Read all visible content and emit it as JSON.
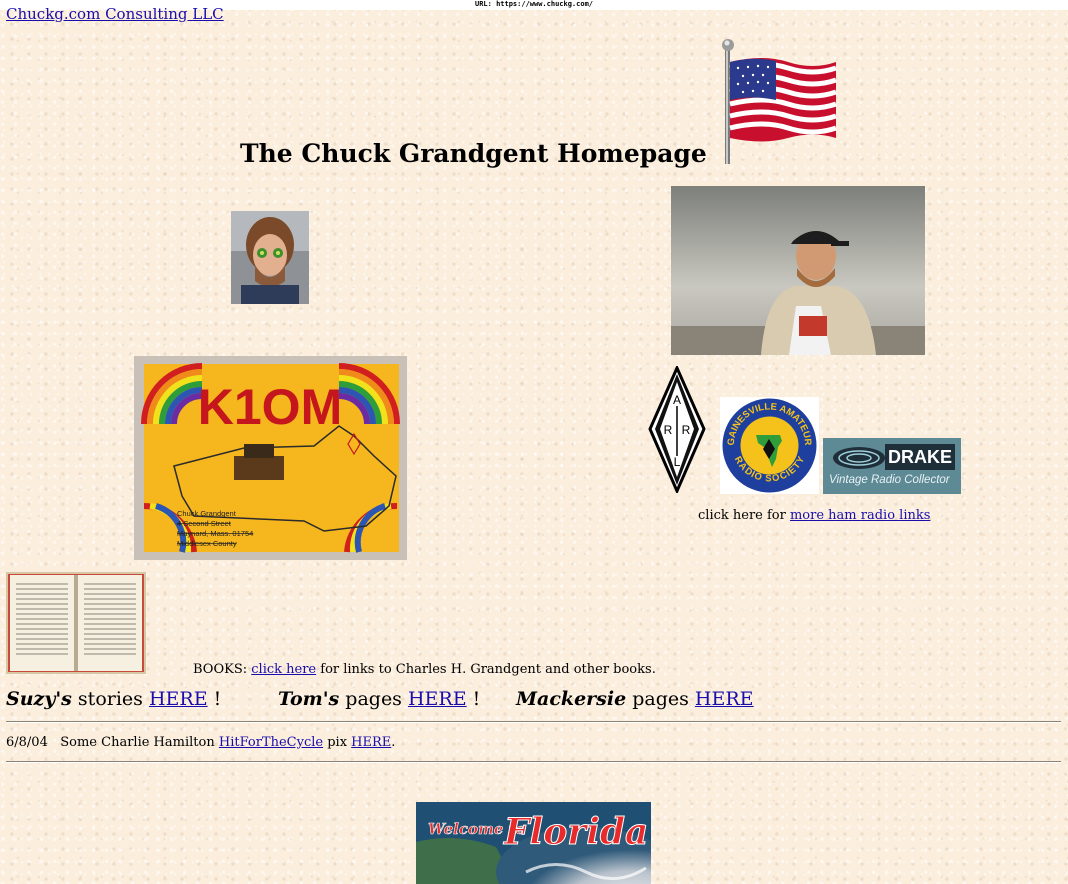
{
  "browser": {
    "url_label": "URL:",
    "url": "https://www.chuckg.com/"
  },
  "header": {
    "company_link": "Chuckg.com Consulting LLC",
    "title": "The Chuck Grandgent Homepage"
  },
  "qsl_card": {
    "callsign": "K1OM",
    "address_lines": [
      "Chuck Grandgent",
      "4 Second Street",
      "Maynard, Mass. 01754",
      "Middlesex County"
    ]
  },
  "ham": {
    "arrl_letters": [
      "A",
      "R",
      "R",
      "L"
    ],
    "gars_lines": [
      "GAINESVILLE AMATEUR",
      "RADIO SOCIETY"
    ],
    "drake_brand": "DRAKE",
    "drake_tagline": "Vintage Radio Collector",
    "links_prefix": "click here for ",
    "links_link": "more ham radio links"
  },
  "books": {
    "prefix": "BOOKS: ",
    "link": "click here",
    "suffix": " for links to Charles H. Grandgent and other books."
  },
  "family": [
    {
      "name": "Suzy's",
      "middle": " stories ",
      "link": "HERE",
      "suffix": " !"
    },
    {
      "name": "Tom's",
      "middle": " pages ",
      "link": "HERE",
      "suffix": " !"
    },
    {
      "name": "Mackersie",
      "middle": " pages ",
      "link": "HERE",
      "suffix": ""
    }
  ],
  "news": {
    "date": "6/8/04",
    "text1": "Some Charlie Hamilton ",
    "link1": "HitForTheCycle",
    "text2": " pix ",
    "link2": "HERE",
    "text3": "."
  },
  "florida": {
    "welcome": "Welcome to",
    "name": "Florida"
  },
  "colors": {
    "link": "#1a0dab",
    "background": "#fbeedd",
    "flag_red": "#c8102e",
    "flag_blue": "#2b3a8c"
  }
}
